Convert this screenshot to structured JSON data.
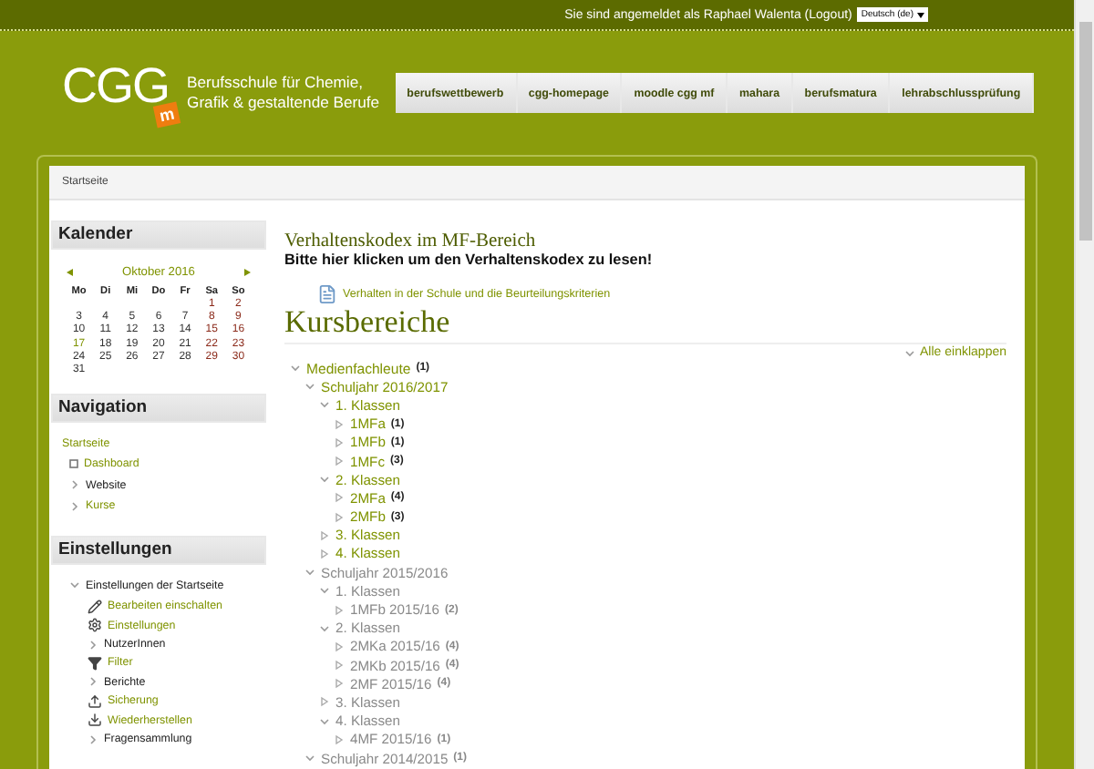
{
  "top_bar": {
    "login_text": "Sie sind angemeldet als",
    "user": "Raphael Walenta",
    "logout": "(Logout)",
    "language": "Deutsch (de)"
  },
  "header": {
    "logo": "CGG",
    "logo_badge": "m",
    "tagline": [
      "Berufsschule für Chemie,",
      "Grafik & gestaltende Berufe"
    ],
    "nav_tabs": [
      "berufswettbewerb",
      "cgg-homepage",
      "moodle cgg mf",
      "mahara",
      "berufsmatura",
      "lehrabschlussprüfung"
    ]
  },
  "breadcrumb": "Startseite",
  "calendar": {
    "title": "Kalender",
    "month": "Oktober 2016",
    "weekdays": [
      "Mo",
      "Di",
      "Mi",
      "Do",
      "Fr",
      "Sa",
      "So"
    ],
    "weeks": [
      {
        "days": [
          {
            "label": "1",
            "weekend": true,
            "today": false
          },
          {
            "label": "2",
            "weekend": true,
            "today": false
          }
        ]
      },
      {
        "days": [
          {
            "label": "3",
            "weekend": false,
            "today": false
          },
          {
            "label": "4",
            "weekend": false,
            "today": false
          },
          {
            "label": "5",
            "weekend": false,
            "today": false
          },
          {
            "label": "6",
            "weekend": false,
            "today": false
          },
          {
            "label": "7",
            "weekend": false,
            "today": false
          },
          {
            "label": "8",
            "weekend": true,
            "today": false
          },
          {
            "label": "9",
            "weekend": true,
            "today": false
          }
        ]
      },
      {
        "days": [
          {
            "label": "10",
            "weekend": false,
            "today": false
          },
          {
            "label": "11",
            "weekend": false,
            "today": false
          },
          {
            "label": "12",
            "weekend": false,
            "today": false
          },
          {
            "label": "13",
            "weekend": false,
            "today": false
          },
          {
            "label": "14",
            "weekend": false,
            "today": false
          },
          {
            "label": "15",
            "weekend": true,
            "today": false
          },
          {
            "label": "16",
            "weekend": true,
            "today": false
          }
        ]
      },
      {
        "days": [
          {
            "label": "17",
            "weekend": false,
            "today": true
          },
          {
            "label": "18",
            "weekend": false,
            "today": false
          },
          {
            "label": "19",
            "weekend": false,
            "today": false
          },
          {
            "label": "20",
            "weekend": false,
            "today": false
          },
          {
            "label": "21",
            "weekend": false,
            "today": false
          },
          {
            "label": "22",
            "weekend": true,
            "today": false
          },
          {
            "label": "23",
            "weekend": true,
            "today": false
          }
        ]
      },
      {
        "days": [
          {
            "label": "24",
            "weekend": false,
            "today": false
          },
          {
            "label": "25",
            "weekend": false,
            "today": false
          },
          {
            "label": "26",
            "weekend": false,
            "today": false
          },
          {
            "label": "27",
            "weekend": false,
            "today": false
          },
          {
            "label": "28",
            "weekend": false,
            "today": false
          },
          {
            "label": "29",
            "weekend": true,
            "today": false
          },
          {
            "label": "30",
            "weekend": true,
            "today": false
          }
        ]
      },
      {
        "days": [
          {
            "label": "31",
            "weekend": false,
            "today": false
          }
        ]
      }
    ]
  },
  "navigation": {
    "title": "Navigation",
    "items": [
      {
        "label": "Startseite",
        "kind": "home",
        "link": true
      },
      {
        "label": "Dashboard",
        "kind": "page",
        "link": true
      },
      {
        "label": "Website",
        "kind": "branch",
        "link": false
      },
      {
        "label": "Kurse",
        "kind": "branch",
        "link": true
      }
    ]
  },
  "settings": {
    "title": "Einstellungen",
    "section": {
      "label": "Einstellungen der Startseite",
      "expanded": true,
      "children": [
        {
          "label": "Bearbeiten einschalten",
          "kind": "edit",
          "link": true
        },
        {
          "label": "Einstellungen",
          "kind": "settings",
          "link": true
        },
        {
          "label": "NutzerInnen",
          "kind": "branch",
          "link": false
        },
        {
          "label": "Filter",
          "kind": "filter",
          "link": true
        },
        {
          "label": "Berichte",
          "kind": "branch",
          "link": false
        },
        {
          "label": "Sicherung",
          "kind": "backup",
          "link": true
        },
        {
          "label": "Wiederherstellen",
          "kind": "restore",
          "link": true
        },
        {
          "label": "Fragensammlung",
          "kind": "branch",
          "link": false
        }
      ]
    }
  },
  "notice": {
    "title": "Verhaltenskodex im MF-Bereich",
    "text": "Bitte hier klicken um den Verhaltenskodex zu lesen!",
    "resource": "Verhalten in der Schule und die Beurteilungskriterien"
  },
  "course_categories": {
    "heading": "Kursbereiche",
    "collapse_all": "Alle einklappen",
    "tree": [
      {
        "label": "Medienfachleute",
        "count": "(1)",
        "expanded": true,
        "dimmed": false,
        "children": [
          {
            "label": "Schuljahr 2016/2017",
            "expanded": true,
            "dimmed": false,
            "children": [
              {
                "label": "1. Klassen",
                "expanded": true,
                "dimmed": false,
                "children": [
                  {
                    "label": "1MFa",
                    "count": "(1)",
                    "expanded": false,
                    "dimmed": false
                  },
                  {
                    "label": "1MFb",
                    "count": "(1)",
                    "expanded": false,
                    "dimmed": false
                  },
                  {
                    "label": "1MFc",
                    "count": "(3)",
                    "expanded": false,
                    "dimmed": false
                  }
                ]
              },
              {
                "label": "2. Klassen",
                "expanded": true,
                "dimmed": false,
                "children": [
                  {
                    "label": "2MFa",
                    "count": "(4)",
                    "expanded": false,
                    "dimmed": false
                  },
                  {
                    "label": "2MFb",
                    "count": "(3)",
                    "expanded": false,
                    "dimmed": false
                  }
                ]
              },
              {
                "label": "3. Klassen",
                "expanded": false,
                "dimmed": false
              },
              {
                "label": "4. Klassen",
                "expanded": false,
                "dimmed": false
              }
            ]
          },
          {
            "label": "Schuljahr 2015/2016",
            "expanded": true,
            "dimmed": true,
            "children": [
              {
                "label": "1. Klassen",
                "expanded": true,
                "dimmed": true,
                "children": [
                  {
                    "label": "1MFb 2015/16",
                    "count": "(2)",
                    "expanded": false,
                    "dimmed": true
                  }
                ]
              },
              {
                "label": "2. Klassen",
                "expanded": true,
                "dimmed": true,
                "children": [
                  {
                    "label": "2MKa 2015/16",
                    "count": "(4)",
                    "expanded": false,
                    "dimmed": true
                  },
                  {
                    "label": "2MKb 2015/16",
                    "count": "(4)",
                    "expanded": false,
                    "dimmed": true
                  },
                  {
                    "label": "2MF 2015/16",
                    "count": "(4)",
                    "expanded": false,
                    "dimmed": true
                  }
                ]
              },
              {
                "label": "3. Klassen",
                "expanded": false,
                "dimmed": true
              },
              {
                "label": "4. Klassen",
                "expanded": true,
                "dimmed": true,
                "children": [
                  {
                    "label": "4MF 2015/16",
                    "count": "(1)",
                    "expanded": false,
                    "dimmed": true
                  }
                ]
              }
            ]
          },
          {
            "label": "Schuljahr 2014/2015",
            "count": "(1)",
            "expanded": true,
            "dimmed": true
          }
        ]
      }
    ]
  }
}
